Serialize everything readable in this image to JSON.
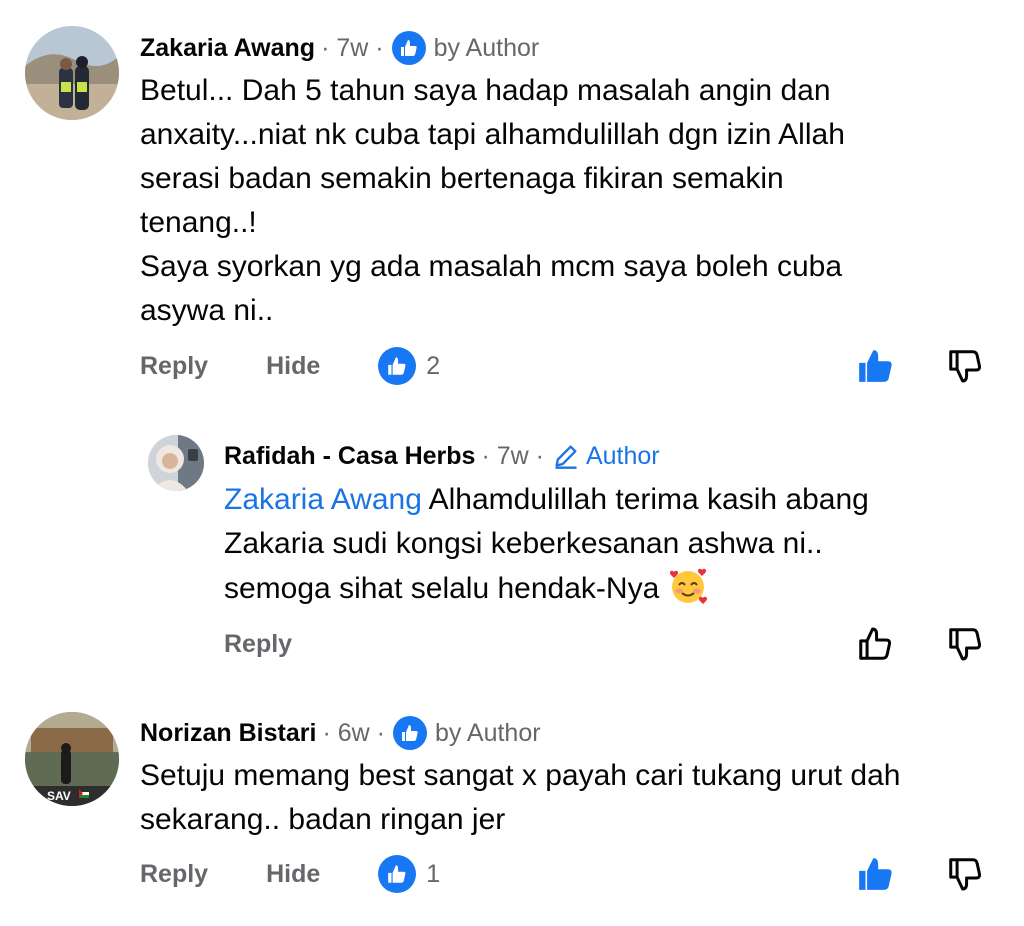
{
  "comments": [
    {
      "name": "Zakaria Awang",
      "time": "· 7w ·",
      "badge_label": "by Author",
      "lines": [
        "Betul... Dah 5 tahun saya hadap masalah angin dan",
        "anxaity...niat nk cuba tapi alhamdulillah dgn izin Allah",
        "serasi badan semakin bertenaga fikiran semakin",
        "tenang..!",
        "Saya syorkan yg ada masalah mcm saya boleh cuba",
        "asywa ni.."
      ],
      "reply_label": "Reply",
      "hide_label": "Hide",
      "like_count": "2",
      "liked": true
    },
    {
      "name": "Rafidah - Casa Herbs",
      "time": "· 7w ·",
      "badge_label": "Author",
      "mention": "Zakaria Awang",
      "lines": [
        "Alhamdulillah terima kasih abang",
        "Zakaria sudi kongsi keberkesanan ashwa ni..",
        "semoga sihat selalu hendak-Nya"
      ],
      "reply_label": "Reply",
      "liked": false
    },
    {
      "name": "Norizan Bistari",
      "time": "· 6w ·",
      "badge_label": "by Author",
      "lines": [
        "Setuju memang best sangat x payah cari tukang urut dah",
        "sekarang.. badan ringan jer"
      ],
      "reply_label": "Reply",
      "hide_label": "Hide",
      "like_count": "1",
      "liked": true,
      "avatar_text": "SAV"
    }
  ],
  "colors": {
    "accent": "#1877f2",
    "mention": "#1b74e4",
    "secondary_text": "#65676b"
  }
}
